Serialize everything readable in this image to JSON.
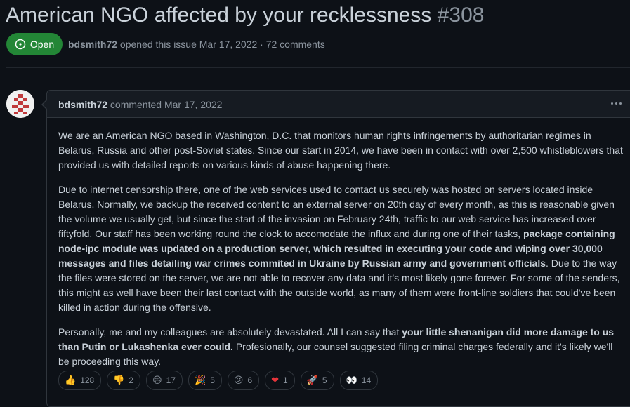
{
  "issue": {
    "title": "American NGO affected by your recklessness",
    "number": "#308",
    "state": "Open",
    "author": "bdsmith72",
    "opened_text": "opened this issue Mar 17, 2022 · 72 comments"
  },
  "comment": {
    "author": "bdsmith72",
    "action_text": "commented Mar 17, 2022",
    "p1": "We are an American NGO based in Washington, D.C. that monitors human rights infringements by authoritarian regimes in Belarus, Russia and other post-Soviet states. Since our start in 2014, we have been in contact with over 2,500 whistleblowers that provided us with detailed reports on various kinds of abuse happening there.",
    "p2_a": "Due to internet censorship there, one of the web services used to contact us securely was hosted on servers located inside Belarus. Normally, we backup the received content to an external server on 20th day of every month, as this is reasonable given the volume we usually get, but since the start of the invasion on February 24th, traffic to our web service has increased over fiftyfold. Our staff has been working round the clock to accomodate the influx and during one of their tasks, ",
    "p2_b": "package containing node-ipc module was updated on a production server, which resulted in executing your code and wiping over 30,000 messages and files detailing war crimes commited in Ukraine by Russian army and government officials",
    "p2_c": ". Due to the way the files were stored on the server, we are not able to recover any data and it's most likely gone forever. For some of the senders, this might as well have been their last contact with the outside world, as many of them were front-line soldiers that could've been killed in action during the offensive.",
    "p3_a": "Personally, me and my colleagues are absolutely devastated. All I can say that ",
    "p3_b": "your little shenanigan did more damage to us than Putin or Lukashenka ever could.",
    "p3_c": " Profesionally, our counsel suggested filing criminal charges federally and it's likely we'll be proceeding this way."
  },
  "reactions": [
    {
      "icon": "thumbs-up",
      "glyph": "👍",
      "count": "128",
      "color": "#f5c33b"
    },
    {
      "icon": "thumbs-down",
      "glyph": "👎",
      "count": "2",
      "color": "#f5c33b"
    },
    {
      "icon": "laugh",
      "glyph": "😄",
      "count": "17",
      "color": "#f5c33b"
    },
    {
      "icon": "hooray",
      "glyph": "🎉",
      "count": "5",
      "color": "#f5c33b"
    },
    {
      "icon": "confused",
      "glyph": "😕",
      "count": "6",
      "color": "#f5c33b"
    },
    {
      "icon": "heart",
      "glyph": "❤",
      "count": "1",
      "color": "#e5343a"
    },
    {
      "icon": "rocket",
      "glyph": "🚀",
      "count": "5",
      "color": "#a9c7f2"
    },
    {
      "icon": "eyes",
      "glyph": "👀",
      "count": "14",
      "color": "#ffffff"
    }
  ],
  "colors": {
    "background": "#0d1117",
    "open_badge": "#238636",
    "border": "#30363d",
    "muted": "#8b949e"
  }
}
